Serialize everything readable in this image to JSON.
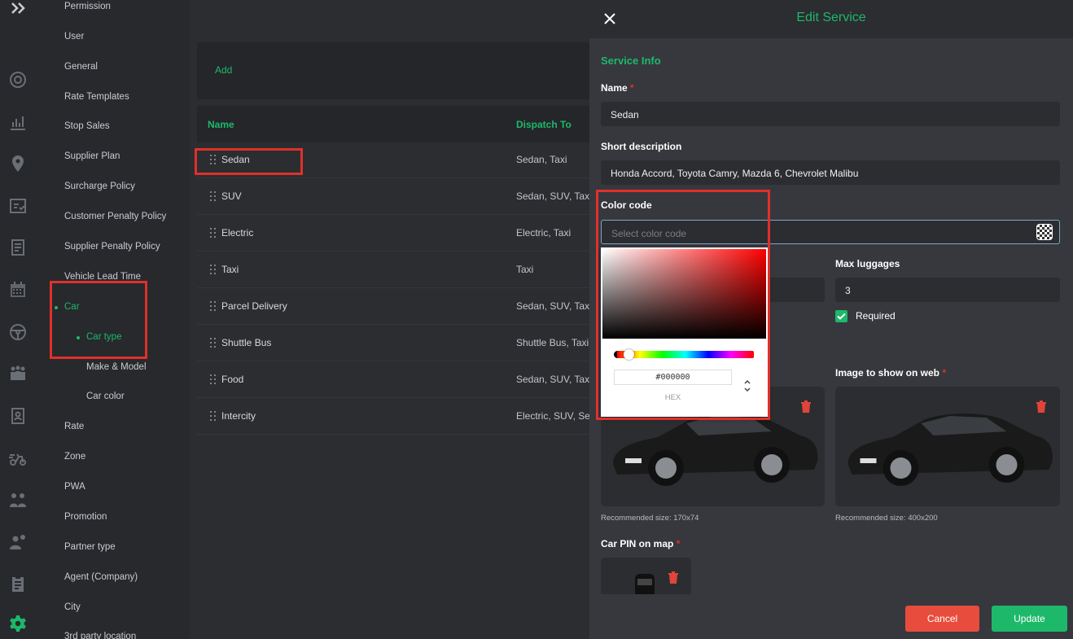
{
  "menu": {
    "items": [
      {
        "label": "Permission"
      },
      {
        "label": "User"
      },
      {
        "label": "General"
      },
      {
        "label": "Rate Templates"
      },
      {
        "label": "Stop Sales"
      },
      {
        "label": "Supplier Plan"
      },
      {
        "label": "Surcharge Policy"
      },
      {
        "label": "Customer Penalty Policy"
      },
      {
        "label": "Supplier Penalty Policy"
      },
      {
        "label": "Vehicle Lead Time"
      },
      {
        "label": "Car"
      },
      {
        "label": "Car type"
      },
      {
        "label": "Make & Model"
      },
      {
        "label": "Car color"
      },
      {
        "label": "Rate"
      },
      {
        "label": "Zone"
      },
      {
        "label": "PWA"
      },
      {
        "label": "Promotion"
      },
      {
        "label": "Partner type"
      },
      {
        "label": "Agent (Company)"
      },
      {
        "label": "City"
      },
      {
        "label": "3rd party location"
      }
    ]
  },
  "list": {
    "add_label": "Add",
    "columns": [
      "Name",
      "Dispatch To"
    ],
    "rows": [
      {
        "name": "Sedan",
        "dispatch": "Sedan, Taxi"
      },
      {
        "name": "SUV",
        "dispatch": "Sedan, SUV, Taxi"
      },
      {
        "name": "Electric",
        "dispatch": "Electric, Taxi"
      },
      {
        "name": "Taxi",
        "dispatch": "Taxi"
      },
      {
        "name": "Parcel Delivery",
        "dispatch": "Sedan, SUV, Taxi,"
      },
      {
        "name": "Shuttle Bus",
        "dispatch": "Shuttle Bus, Taxi"
      },
      {
        "name": "Food",
        "dispatch": "Sedan, SUV, Taxi,"
      },
      {
        "name": "Intercity",
        "dispatch": "Electric, SUV, Sed"
      }
    ]
  },
  "drawer": {
    "title": "Edit Service",
    "section": "Service Info",
    "name_label": "Name",
    "name_value": "Sedan",
    "short_desc_label": "Short description",
    "short_desc_value": "Honda Accord, Toyota Camry, Mazda 6, Chevrolet Malibu",
    "color_label": "Color code",
    "color_placeholder": "Select color code",
    "max_luggage_label": "Max luggages",
    "max_luggage_value": "3",
    "required_label": "Required",
    "image_web_label": "Image to show on web",
    "rec_size_app": "Recommended size: 170x74",
    "rec_size_web": "Recommended size: 400x200",
    "car_pin_label": "Car PIN on map",
    "required_mark": "*",
    "cancel_label": "Cancel",
    "update_label": "Update"
  },
  "picker": {
    "hex_value": "#000000",
    "mode_label": "HEX"
  },
  "colors": {
    "accent": "#1db86a",
    "danger": "#e84c3d",
    "highlight": "#e0302a"
  }
}
